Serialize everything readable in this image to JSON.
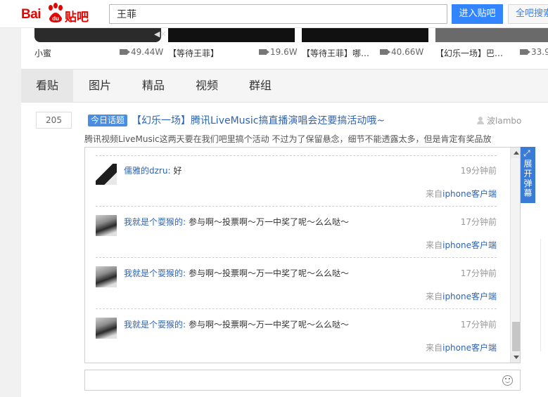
{
  "header": {
    "logo_bai": "Bai",
    "logo_du": "du",
    "logo_tieba": "贴吧",
    "search_value": "王菲",
    "enter_button": "进入贴吧",
    "all_button": "全吧搜索"
  },
  "videos": [
    {
      "caption": "小蜜",
      "count": ""
    },
    {
      "caption": "【等待王菲】",
      "count": "49.44W"
    },
    {
      "caption": "【等待王菲】哪…",
      "count": "19.6W"
    },
    {
      "caption": "【幻乐一场】巴…",
      "count": "40.66W"
    },
    {
      "caption": "",
      "count": "33.9"
    }
  ],
  "tabs": [
    "看贴",
    "图片",
    "精品",
    "视频",
    "群组"
  ],
  "post": {
    "reply_count": "205",
    "badge": "今日话题",
    "title": "【幻乐一场】腾讯LiveMusic搞直播演唱会还要搞活动哦~",
    "author": "波lambo",
    "abstract": "腾讯视频LiveMusic这两天要在我们吧里搞个活动 不过为了保留悬念，细节不能透露太多，但是肯定有奖品放"
  },
  "comments": [
    {
      "name": "儒雅的dzru:",
      "text": "好",
      "time": "19分钟前",
      "source_prefix": "来自",
      "device": "iphone客户端"
    },
    {
      "name": "我就是个耍猴的:",
      "text": "参与啊～投票啊～万一中奖了呢～么么哒～",
      "time": "17分钟前",
      "source_prefix": "来自",
      "device": "iphone客户端"
    },
    {
      "name": "我就是个耍猴的:",
      "text": "参与啊～投票啊～万一中奖了呢～么么哒～",
      "time": "17分钟前",
      "source_prefix": "来自",
      "device": "iphone客户端"
    },
    {
      "name": "我就是个耍猴的:",
      "text": "参与啊～投票啊～万一中奖了呢～么么哒～",
      "time": "17分钟前",
      "source_prefix": "来自",
      "device": "iphone客户端"
    }
  ],
  "danmaku_label": "展开弹幕",
  "colors": {
    "brand_red": "#e10602",
    "link_blue": "#2d64b3",
    "button_blue": "#3385ff",
    "badge_blue": "#4a8de3"
  }
}
